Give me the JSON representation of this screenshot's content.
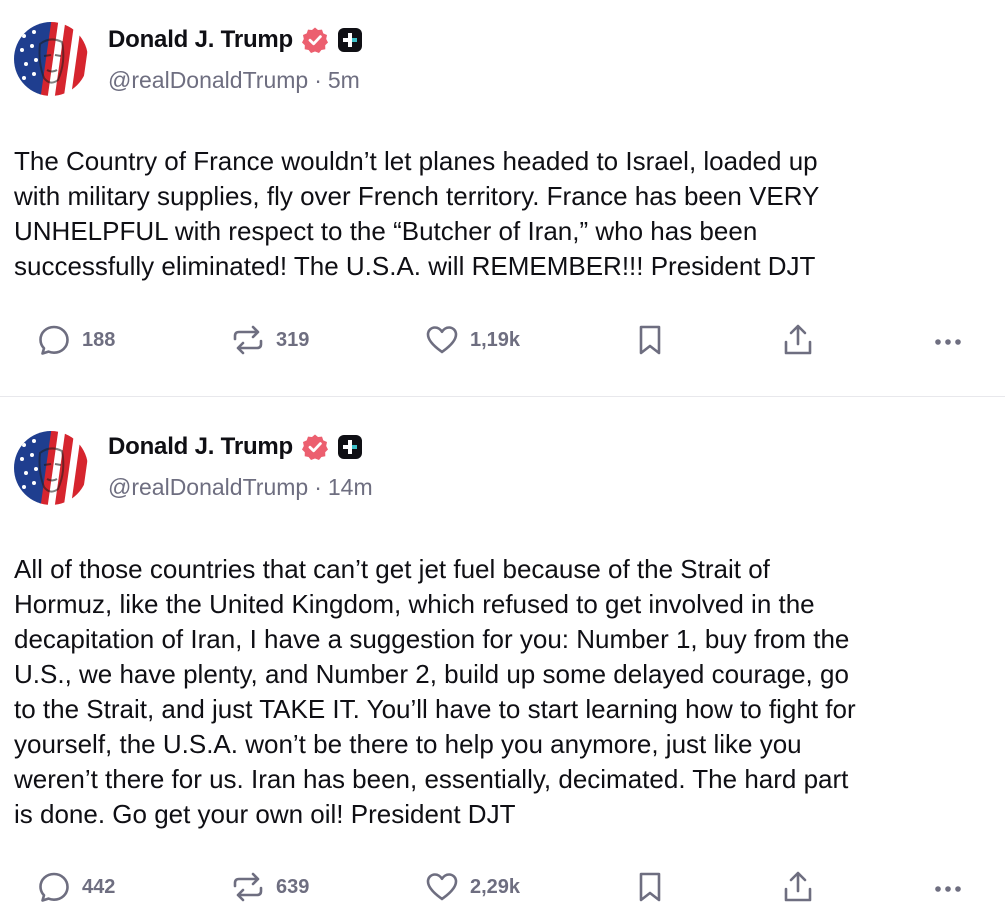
{
  "colors": {
    "text": "#0f0f14",
    "muted": "#6e6e80",
    "verified_badge": "#ec5f6f",
    "divider": "#e8e8ec"
  },
  "posts": [
    {
      "author": {
        "display_name": "Donald J. Trump",
        "handle": "@realDonaldTrump",
        "verified_icon": "verified-badge-icon",
        "extra_icon": "plus-badge-icon"
      },
      "separator": "·",
      "time": "5m",
      "text": "The Country of France wouldn’t let planes headed to Israel, loaded up\nwith military supplies, fly over French territory. France has been VERY\nUNHELPFUL with respect to the “Butcher of Iran,” who has been\nsuccessfully eliminated! The U.S.A. will REMEMBER!!! President DJT",
      "actions": {
        "replies": "188",
        "reposts": "319",
        "likes": "1,19k"
      }
    },
    {
      "author": {
        "display_name": "Donald J. Trump",
        "handle": "@realDonaldTrump",
        "verified_icon": "verified-badge-icon",
        "extra_icon": "plus-badge-icon"
      },
      "separator": "·",
      "time": "14m",
      "text": "All of those countries that can’t get jet fuel because of the Strait of\nHormuz, like the United Kingdom, which refused to get involved in the\ndecapitation of Iran, I have a suggestion for you: Number 1, buy from the\nU.S., we have plenty, and Number 2, build up some delayed courage, go\nto the Strait, and just TAKE IT. You’ll have to start learning how to fight for\nyourself, the U.S.A. won’t be there to help you anymore, just like you\nweren’t there for us. Iran has been, essentially, decimated. The hard part\nis done. Go get your own oil! President DJT",
      "actions": {
        "replies": "442",
        "reposts": "639",
        "likes": "2,29k"
      }
    }
  ]
}
